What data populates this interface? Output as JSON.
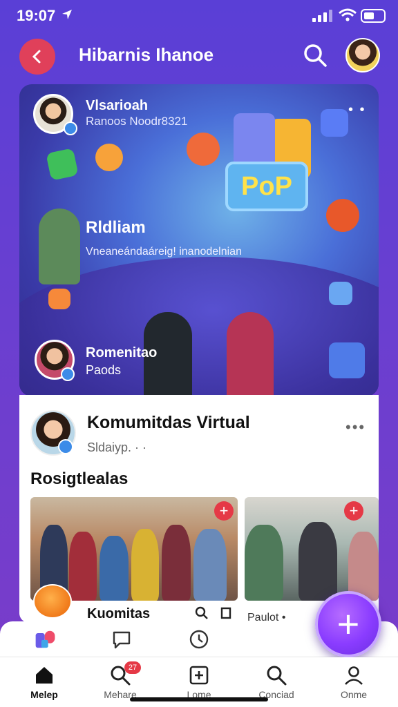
{
  "status": {
    "time": "19:07"
  },
  "header": {
    "title": "Hibarnis Ihanoe"
  },
  "hero": {
    "name": "Vlsarioah",
    "subname": "Ranoos Noodr8321",
    "more": "• •",
    "title": "Rldliam",
    "description": "Vneaneándaáreig! inanodelnian",
    "pop_label": "PoP",
    "bottom_title": "Romenitao",
    "bottom_sub": "Paods"
  },
  "community": {
    "title": "Komumitdas Virtual",
    "subtitle": "Sldaiyp. · ·",
    "more": "•••",
    "section_title": "Rosigtlealas",
    "card1_label": "Kuomitas",
    "card2_label": "Paulot •",
    "plus": "+"
  },
  "fab": {
    "label": "+"
  },
  "bottom_nav": {
    "items": [
      {
        "label": "Melep",
        "icon": "home-icon",
        "active": true
      },
      {
        "label": "Mehare",
        "icon": "search-icon",
        "badge": "27"
      },
      {
        "label": "Lome",
        "icon": "add-square-icon"
      },
      {
        "label": "Conciad",
        "icon": "search-icon"
      },
      {
        "label": "Onme",
        "icon": "profile-icon"
      }
    ]
  },
  "colors": {
    "accent": "#7b3cc9",
    "back_button": "#e0405a",
    "badge": "#e53946",
    "fab": "#8a3cff"
  }
}
